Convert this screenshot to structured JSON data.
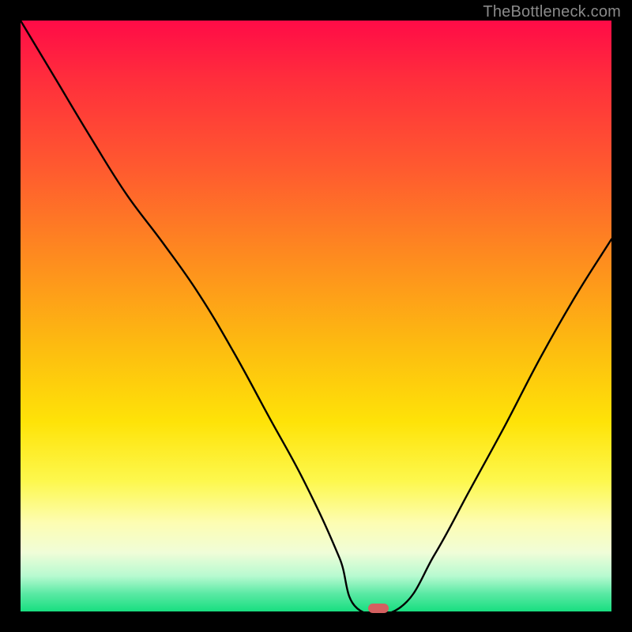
{
  "watermark": "TheBottleneck.com",
  "marker": {
    "x_frac": 0.605,
    "y_frac": 0.994,
    "color": "#d46060"
  },
  "chart_data": {
    "type": "line",
    "title": "",
    "xlabel": "",
    "ylabel": "",
    "xlim": [
      0,
      1
    ],
    "ylim": [
      0,
      1
    ],
    "series": [
      {
        "name": "bottleneck-curve",
        "x": [
          0.0,
          0.06,
          0.12,
          0.18,
          0.24,
          0.3,
          0.36,
          0.42,
          0.48,
          0.54,
          0.57,
          0.64,
          0.7,
          0.76,
          0.82,
          0.88,
          0.94,
          1.0
        ],
        "y": [
          1.0,
          0.9,
          0.8,
          0.705,
          0.625,
          0.54,
          0.44,
          0.33,
          0.22,
          0.09,
          0.005,
          0.005,
          0.095,
          0.205,
          0.315,
          0.43,
          0.535,
          0.63
        ]
      }
    ],
    "gradient_stops": [
      {
        "pos": 0.0,
        "color": "#ff0b47"
      },
      {
        "pos": 0.1,
        "color": "#ff2e3c"
      },
      {
        "pos": 0.25,
        "color": "#ff5a2f"
      },
      {
        "pos": 0.4,
        "color": "#fe8b1f"
      },
      {
        "pos": 0.55,
        "color": "#fdbb10"
      },
      {
        "pos": 0.68,
        "color": "#fee308"
      },
      {
        "pos": 0.78,
        "color": "#fdf84e"
      },
      {
        "pos": 0.85,
        "color": "#fdfdb2"
      },
      {
        "pos": 0.9,
        "color": "#f0fdd8"
      },
      {
        "pos": 0.94,
        "color": "#b7fad0"
      },
      {
        "pos": 0.97,
        "color": "#5ae9a4"
      },
      {
        "pos": 1.0,
        "color": "#18de80"
      }
    ]
  }
}
